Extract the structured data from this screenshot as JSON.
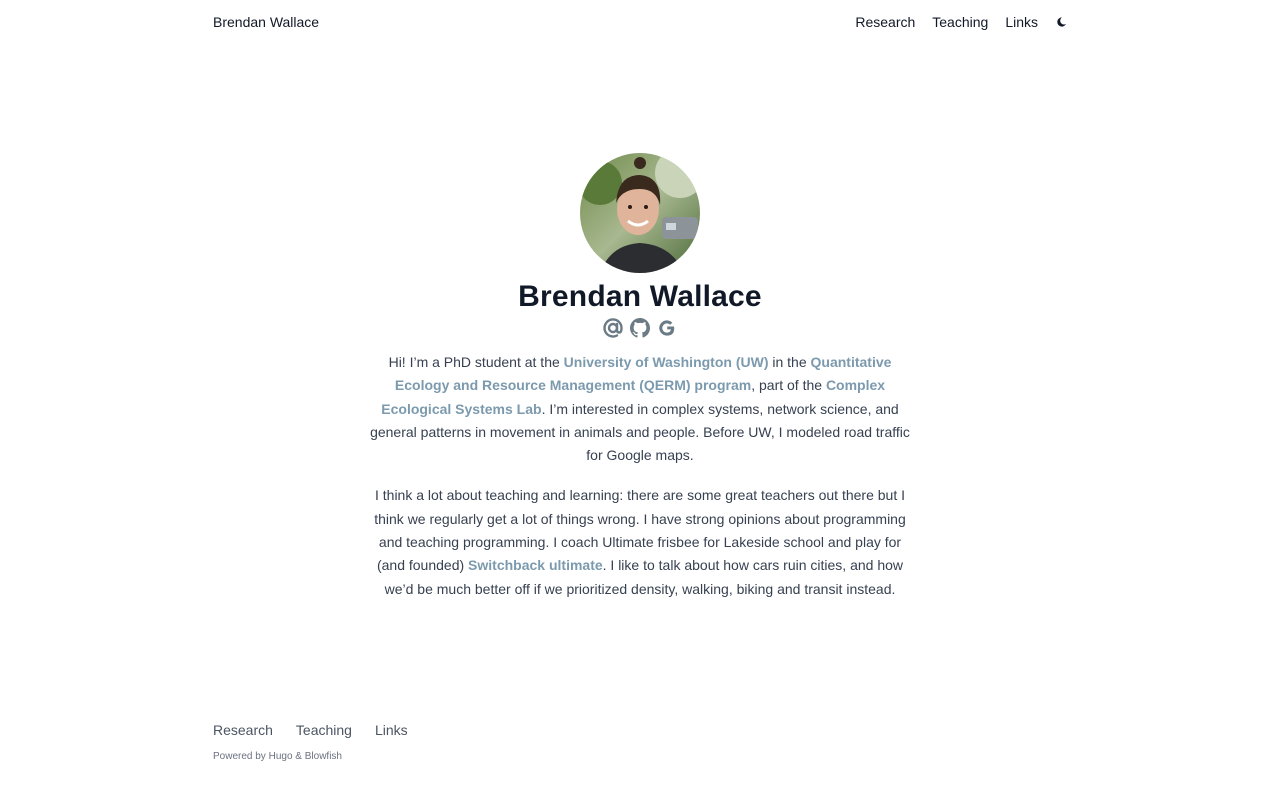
{
  "header": {
    "site_title": "Brendan Wallace",
    "nav": [
      {
        "label": "Research"
      },
      {
        "label": "Teaching"
      },
      {
        "label": "Links"
      }
    ],
    "theme_toggle_icon": "moon-icon"
  },
  "profile": {
    "name": "Brendan Wallace",
    "avatar_icon": "profile-photo",
    "socials": [
      {
        "icon": "email-icon"
      },
      {
        "icon": "github-icon"
      },
      {
        "icon": "google-scholar-icon"
      }
    ]
  },
  "bio": {
    "p1": {
      "t1": "Hi! I’m a PhD student at the ",
      "link1": "University of Washington (UW)",
      "t2": " in the ",
      "link2": "Quantitative Ecology and Resource Management (QERM) program",
      "t3": ", part of the ",
      "link3": "Complex Ecological Systems Lab",
      "t4": ". I’m interested in complex systems, network science, and general patterns in movement in animals and people. Before UW, I modeled road traffic for Google maps."
    },
    "p2": {
      "t1": "I think a lot about teaching and learning: there are some great teachers out there but I think we regularly get a lot of things wrong. I have strong opinions about programming and teaching programming. I coach Ultimate frisbee for Lakeside school and play for (and founded) ",
      "link1": "Switchback ultimate",
      "t2": ". I like to talk about how cars ruin cities, and how we’d be much better off if we prioritized density, walking, biking and transit instead."
    }
  },
  "footer": {
    "nav": [
      {
        "label": "Research"
      },
      {
        "label": "Teaching"
      },
      {
        "label": "Links"
      }
    ],
    "powered_prefix": "Powered by ",
    "hugo": "Hugo",
    "amp": " & ",
    "blowfish": "Blowfish"
  },
  "colors": {
    "link": "#7c9aae",
    "text": "#374151",
    "heading": "#111827"
  }
}
